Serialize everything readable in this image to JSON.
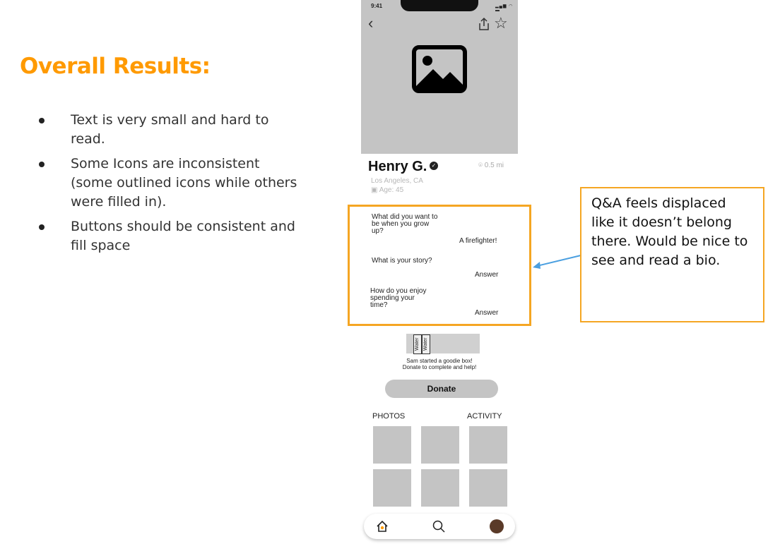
{
  "slide": {
    "title": "Overall Results:",
    "bullets": [
      "Text is very small and hard to read.",
      "Some Icons are inconsistent (some outlined icons while others were filled in).",
      "Buttons should be consistent and fill space"
    ],
    "callout": "Q&A feels displaced like it doesn’t belong there. Would be nice to see and read a bio."
  },
  "phone": {
    "status_time": "9:41",
    "status_icons": "▂▄▆ ◠ ▬",
    "name": "Henry G.",
    "distance": "0.5 mi",
    "location": "Los Angeles, CA",
    "age": "Age: 45",
    "qa": [
      {
        "question": "What did you want to be when you grow up?",
        "answer": "A firefighter!"
      },
      {
        "question": "What is your story?",
        "answer": "Answer"
      },
      {
        "question": "How do you enjoy spending your time?",
        "answer": "Answer"
      }
    ],
    "goodie_items": [
      "Water",
      "Water"
    ],
    "goodie_caption_1": "Sam started a goodie box!",
    "goodie_caption_2": "Donate to complete and help!",
    "donate_label": "Donate",
    "photos_tab": "PHOTOS",
    "activity_tab": "ACTIVITY"
  },
  "colors": {
    "accent_orange": "#ff9a00",
    "box_border": "#f5a623",
    "arrow_blue": "#4a9fe0",
    "placeholder_gray": "#c4c4c4"
  }
}
